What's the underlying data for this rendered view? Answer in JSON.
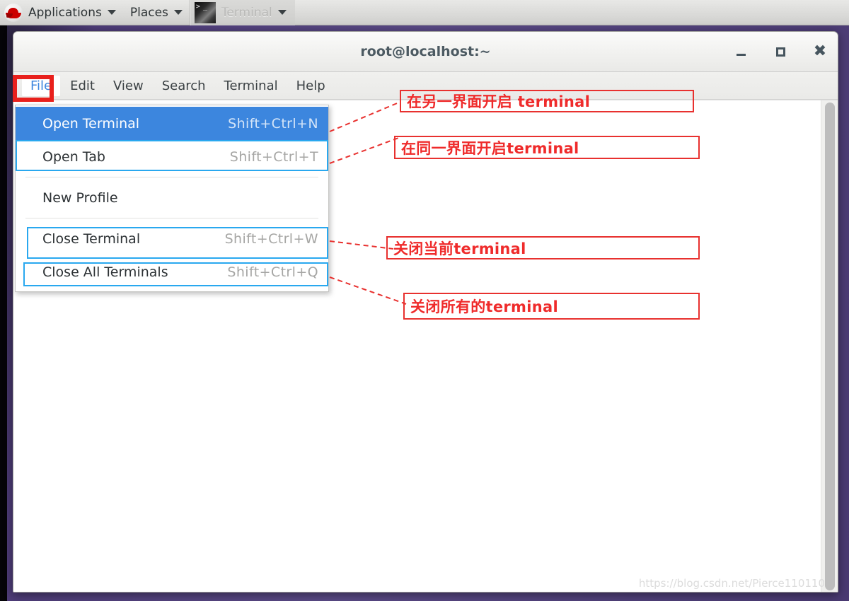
{
  "panel": {
    "logo_icon": "redhat-logo-icon",
    "items": [
      {
        "label": "Applications",
        "caret": "chevron-down-icon"
      },
      {
        "label": "Places",
        "caret": "chevron-down-icon"
      }
    ],
    "window_tab": {
      "label": "Terminal",
      "icon": "terminal-icon",
      "caret": "chevron-down-icon"
    }
  },
  "window": {
    "title": "root@localhost:~",
    "controls": {
      "minimize": "minimize-icon",
      "maximize": "maximize-icon",
      "close": "close-icon"
    },
    "menubar": [
      {
        "label": "File",
        "active": true
      },
      {
        "label": "Edit",
        "active": false
      },
      {
        "label": "View",
        "active": false
      },
      {
        "label": "Search",
        "active": false
      },
      {
        "label": "Terminal",
        "active": false
      },
      {
        "label": "Help",
        "active": false
      }
    ],
    "watermark": "https://blog.csdn.net/Pierce110110"
  },
  "file_menu": {
    "items": [
      {
        "label": "Open Terminal",
        "accel": "Shift+Ctrl+N",
        "highlighted": true
      },
      {
        "label": "Open Tab",
        "accel": "Shift+Ctrl+T",
        "highlighted": false
      },
      {
        "label": "New Profile",
        "accel": "",
        "highlighted": false
      },
      {
        "label": "Close Terminal",
        "accel": "Shift+Ctrl+W",
        "highlighted": false
      },
      {
        "label": "Close All Terminals",
        "accel": "Shift+Ctrl+Q",
        "highlighted": false
      }
    ]
  },
  "annotations": [
    {
      "text": "在另一界面开启 terminal"
    },
    {
      "text": "在同一界面开启terminal"
    },
    {
      "text": "关闭当前terminal"
    },
    {
      "text": "关闭所有的terminal"
    }
  ],
  "colors": {
    "accent_blue": "#3c86de",
    "annotation_red": "#ef2b2b",
    "outline_cyan": "#29a8ef",
    "desktop_purple": "#4a3a72"
  }
}
